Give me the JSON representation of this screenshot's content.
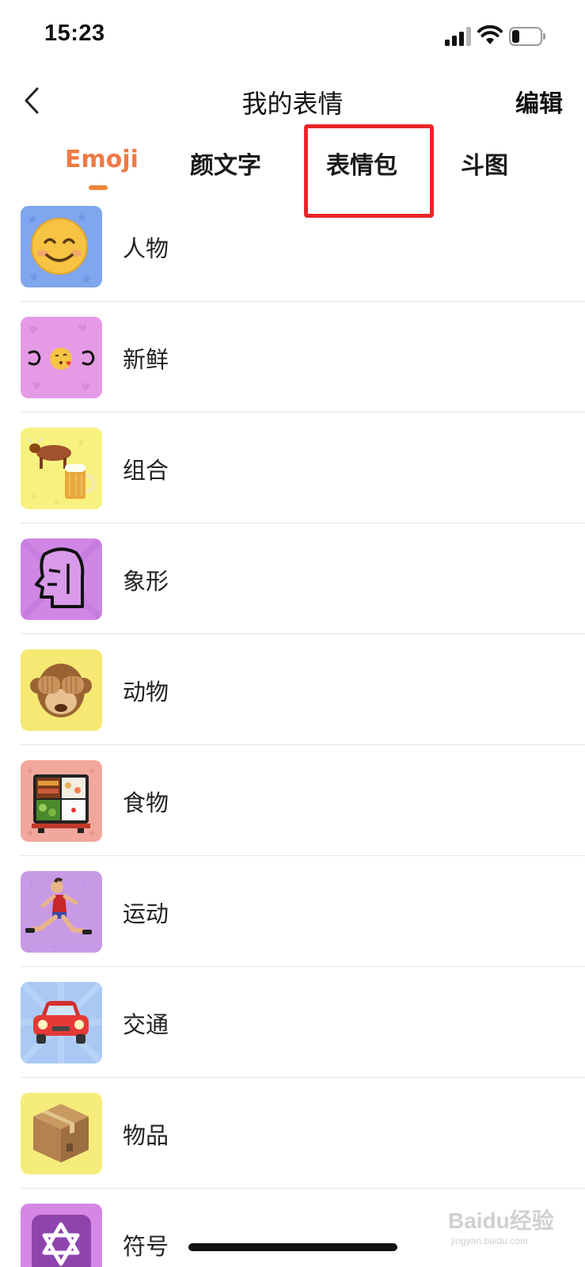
{
  "status_bar": {
    "time": "15:23",
    "signal_icon": "cellular-signal-icon",
    "wifi_icon": "wifi-icon",
    "battery_icon": "battery-low-icon"
  },
  "nav": {
    "back_icon": "chevron-left-icon",
    "title": "我的表情",
    "edit_label": "编辑"
  },
  "tabs": [
    {
      "label": "Emoji",
      "active": true
    },
    {
      "label": "颜文字",
      "active": false
    },
    {
      "label": "表情包",
      "active": false,
      "highlighted": true
    },
    {
      "label": "斗图",
      "active": false
    }
  ],
  "colors": {
    "active_tab": "#ef7a45",
    "tab_indicator": "#f0853c",
    "highlight_box": "#e8262a"
  },
  "categories": [
    {
      "label": "人物",
      "icon": "smiling-face-icon",
      "bg": "#7fa6ee"
    },
    {
      "label": "新鲜",
      "icon": "kissing-face-kaomoji-icon",
      "bg": "#e59ae6"
    },
    {
      "label": "组合",
      "icon": "cow-and-beer-icon",
      "bg": "#f7f27f"
    },
    {
      "label": "象形",
      "icon": "profile-head-glyph-icon",
      "bg": "#cf86e4"
    },
    {
      "label": "动物",
      "icon": "see-no-evil-monkey-icon",
      "bg": "#f6e873"
    },
    {
      "label": "食物",
      "icon": "bento-box-icon",
      "bg": "#f2a79c"
    },
    {
      "label": "运动",
      "icon": "running-person-icon",
      "bg": "#c79ae6"
    },
    {
      "label": "交通",
      "icon": "red-car-icon",
      "bg": "#a9c9f4"
    },
    {
      "label": "物品",
      "icon": "package-box-icon",
      "bg": "#f6ec7c"
    },
    {
      "label": "符号",
      "icon": "star-of-david-icon",
      "bg": "#d487e4"
    }
  ],
  "watermark": {
    "main": "Baidu经验",
    "sub": "jingyan.baidu.com"
  }
}
